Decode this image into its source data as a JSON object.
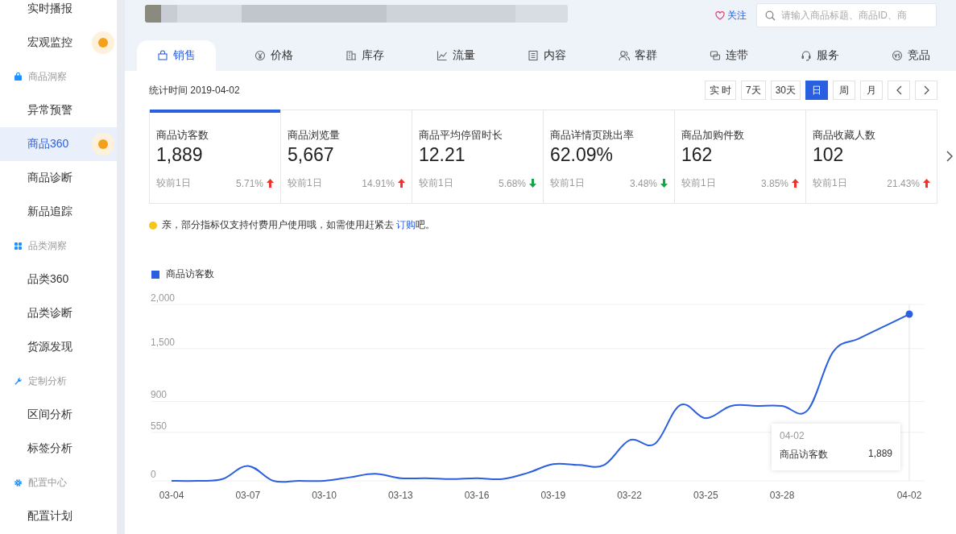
{
  "sidebar": {
    "items": [
      {
        "kind": "link",
        "label": "实时播报",
        "selected": false,
        "badge": false
      },
      {
        "kind": "link",
        "label": "宏观监控",
        "selected": false,
        "badge": true
      },
      {
        "kind": "group",
        "label": "商品洞察"
      },
      {
        "kind": "link",
        "label": "异常预警",
        "selected": false,
        "badge": false
      },
      {
        "kind": "link",
        "label": "商品360",
        "selected": true,
        "badge": true
      },
      {
        "kind": "link",
        "label": "商品诊断",
        "selected": false,
        "badge": false
      },
      {
        "kind": "link",
        "label": "新品追踪",
        "selected": false,
        "badge": false
      },
      {
        "kind": "group",
        "label": "品类洞察"
      },
      {
        "kind": "link",
        "label": "品类360",
        "selected": false,
        "badge": false
      },
      {
        "kind": "link",
        "label": "品类诊断",
        "selected": false,
        "badge": false
      },
      {
        "kind": "link",
        "label": "货源发现",
        "selected": false,
        "badge": false
      },
      {
        "kind": "group",
        "label": "定制分析"
      },
      {
        "kind": "link",
        "label": "区间分析",
        "selected": false,
        "badge": false
      },
      {
        "kind": "link",
        "label": "标签分析",
        "selected": false,
        "badge": false
      },
      {
        "kind": "group",
        "label": "配置中心"
      },
      {
        "kind": "link",
        "label": "配置计划",
        "selected": false,
        "badge": false
      }
    ]
  },
  "header": {
    "follow": "关注",
    "search": {
      "placeholder": "请输入商品标题、商品ID、商"
    }
  },
  "tabs": [
    {
      "label": "销售",
      "selected": true
    },
    {
      "label": "价格",
      "selected": false
    },
    {
      "label": "库存",
      "selected": false
    },
    {
      "label": "流量",
      "selected": false
    },
    {
      "label": "内容",
      "selected": false
    },
    {
      "label": "客群",
      "selected": false
    },
    {
      "label": "连带",
      "selected": false
    },
    {
      "label": "服务",
      "selected": false
    },
    {
      "label": "竞品",
      "selected": false
    }
  ],
  "stat_date": "统计时间 2019-04-02",
  "periods": [
    {
      "label": "实 时",
      "selected": false
    },
    {
      "label": "7天",
      "selected": false
    },
    {
      "label": "30天",
      "selected": false
    },
    {
      "label": "日",
      "selected": true
    },
    {
      "label": "周",
      "selected": false
    },
    {
      "label": "月",
      "selected": false
    }
  ],
  "metrics": [
    {
      "label": "商品访客数",
      "value": "1,889",
      "compare": "较前1日",
      "change": "5.71%",
      "increase": true,
      "selected": true
    },
    {
      "label": "商品浏览量",
      "value": "5,667",
      "compare": "较前1日",
      "change": "14.91%",
      "increase": true,
      "selected": false
    },
    {
      "label": "商品平均停留时长",
      "value": "12.21",
      "compare": "较前1日",
      "change": "5.68%",
      "increase": false,
      "selected": false
    },
    {
      "label": "商品详情页跳出率",
      "value": "62.09%",
      "compare": "较前1日",
      "change": "3.48%",
      "increase": false,
      "selected": false
    },
    {
      "label": "商品加购件数",
      "value": "162",
      "compare": "较前1日",
      "change": "3.85%",
      "increase": true,
      "selected": false
    },
    {
      "label": "商品收藏人数",
      "value": "102",
      "compare": "较前1日",
      "change": "21.43%",
      "increase": true,
      "selected": false
    }
  ],
  "notice": {
    "text": "亲，部分指标仅支持付费用户使用哦，如需使用赶紧去",
    "link": "订购",
    "suffix": "吧。"
  },
  "chart": {
    "chart_data": {
      "type": "line",
      "categories": [
        "03-04",
        null,
        null,
        "03-07",
        null,
        null,
        "03-10",
        null,
        null,
        "03-13",
        null,
        null,
        "03-16",
        null,
        null,
        "03-19",
        null,
        null,
        "03-22",
        null,
        null,
        "03-25",
        null,
        null,
        "03-28",
        null,
        null,
        null,
        null,
        "04-02"
      ],
      "series": [
        {
          "name": "商品访客数",
          "color": "#2a5fe0",
          "values": [
            0,
            0,
            20,
            170,
            0,
            0,
            0,
            40,
            80,
            30,
            30,
            20,
            30,
            20,
            90,
            190,
            180,
            180,
            460,
            420,
            860,
            710,
            850,
            850,
            850,
            800,
            1460,
            1610,
            1750,
            1890
          ]
        }
      ],
      "ylim": [
        0,
        2000
      ],
      "yticks": [
        0,
        550,
        900,
        {
          "value": 1500,
          "label": "1,500"
        },
        {
          "value": 2000,
          "label": "2,000"
        }
      ],
      "grid": true
    },
    "tooltip": {
      "title": "04-02",
      "name": "商品访客数",
      "value": "1,889"
    }
  }
}
